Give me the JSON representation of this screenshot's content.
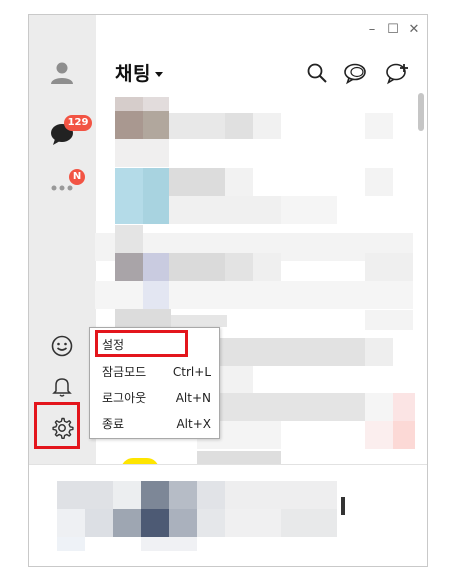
{
  "window": {
    "minimize_glyph": "–",
    "maximize_glyph": "☐",
    "close_glyph": "✕"
  },
  "sidebar": {
    "chat_badge": "129",
    "more_badge": "N"
  },
  "header": {
    "title": "채팅"
  },
  "context_menu": {
    "items": [
      {
        "label": "설정",
        "shortcut": ""
      },
      {
        "label": "잠금모드",
        "shortcut": "Ctrl+L"
      },
      {
        "label": "로그아웃",
        "shortcut": "Alt+N"
      },
      {
        "label": "종료",
        "shortcut": "Alt+X"
      }
    ]
  },
  "icons": {
    "profile": "person-icon",
    "chat": "chat-bubble-icon",
    "more": "more-dots-icon",
    "emoji": "emoji-icon",
    "notifications": "bell-icon",
    "settings": "gear-icon",
    "search": "search-icon",
    "open_chat": "open-chat-icon",
    "new_chat": "new-chat-icon"
  },
  "colors": {
    "badge": "#f25444",
    "highlight": "#e3151c",
    "sidebar": "#ececec",
    "accent_yellow": "#fee500"
  }
}
